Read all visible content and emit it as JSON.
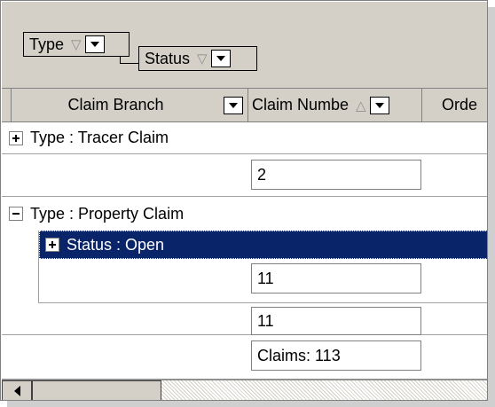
{
  "group_by": {
    "chips": [
      {
        "label": "Type",
        "sort_glyph": "▽"
      },
      {
        "label": "Status",
        "sort_glyph": "▽"
      }
    ]
  },
  "columns": [
    {
      "label": "Claim Branch",
      "sort_glyph": ""
    },
    {
      "label": "Claim Numbe",
      "sort_glyph": "△"
    },
    {
      "label": "Orde",
      "sort_glyph": ""
    }
  ],
  "rows": {
    "tracer_group": {
      "label": "Type : Tracer Claim",
      "expander": "+"
    },
    "tracer_count": "2",
    "property_group": {
      "label": "Type : Property Claim",
      "expander": "−"
    },
    "open_group": {
      "label": "Status : Open",
      "expander": "+"
    },
    "open_count": "11",
    "property_count": "11",
    "total": "Claims: 113"
  },
  "colors": {
    "selection_bg": "#0a246a",
    "panel_bg": "#d4d0c8",
    "border": "#808080"
  }
}
